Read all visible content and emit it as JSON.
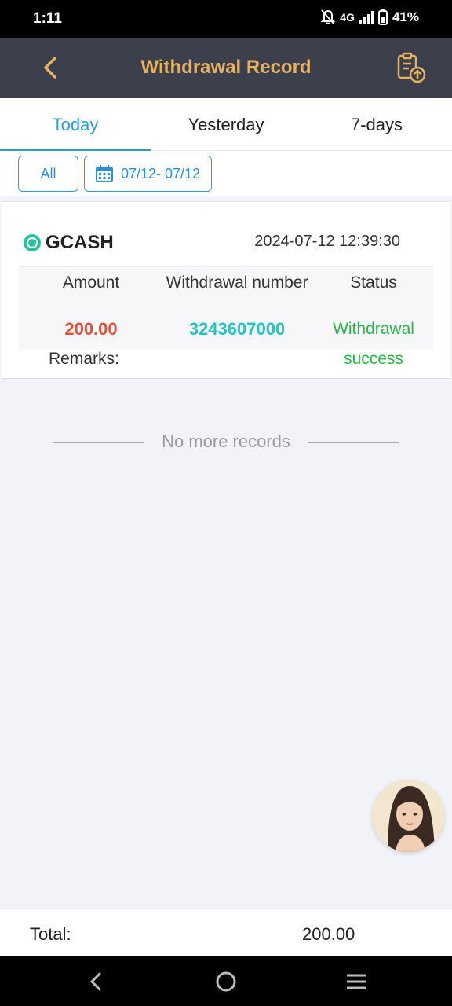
{
  "status_bar": {
    "time": "1:11",
    "network": "4G",
    "battery": "41%"
  },
  "header": {
    "title": "Withdrawal Record",
    "accent_color": "#e7b15f"
  },
  "tabs": [
    {
      "label": "Today",
      "active": true
    },
    {
      "label": "Yesterday",
      "active": false
    },
    {
      "label": "7-days",
      "active": false
    }
  ],
  "filters": {
    "all_label": "All",
    "date_range": "07/12- 07/12"
  },
  "record": {
    "provider": "GCASH",
    "datetime": "2024-07-12 12:39:30",
    "columns": {
      "amount": "Amount",
      "number": "Withdrawal number",
      "status": "Status"
    },
    "amount": "200.00",
    "withdrawal_number": "3243607000",
    "status_line1": "Withdrawal",
    "status_line2": "success",
    "remarks_label": "Remarks:"
  },
  "list_end_text": "No more records",
  "total": {
    "label": "Total:",
    "value": "200.00"
  },
  "colors": {
    "tab_active": "#2b9ad6",
    "amount": "#e0533a",
    "number": "#26c4c0",
    "status_success": "#2db34a"
  }
}
